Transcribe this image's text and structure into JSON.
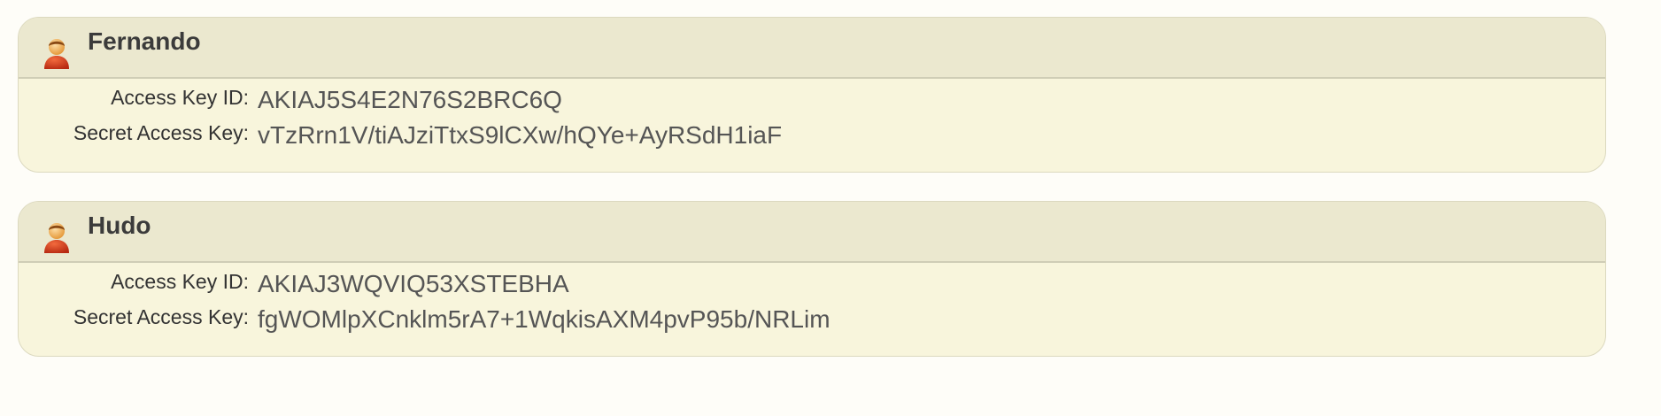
{
  "users": [
    {
      "name": "Fernando",
      "icon": "user-icon",
      "access_key_id_label": "Access Key ID:",
      "access_key_id": "AKIAJ5S4E2N76S2BRC6Q",
      "secret_access_key_label": "Secret Access Key:",
      "secret_access_key": "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"
    },
    {
      "name": "Hudo",
      "icon": "user-icon",
      "access_key_id_label": "Access Key ID:",
      "access_key_id": "AKIAJ3WQVIQ53XSTEBHA",
      "secret_access_key_label": "Secret Access Key:",
      "secret_access_key": "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"
    }
  ],
  "colors": {
    "card_background": "#f8f5dc",
    "header_background": "#ebe8cf",
    "border": "#dcd9bf",
    "icon_body": "#d9401f",
    "icon_head": "#f2b463"
  }
}
